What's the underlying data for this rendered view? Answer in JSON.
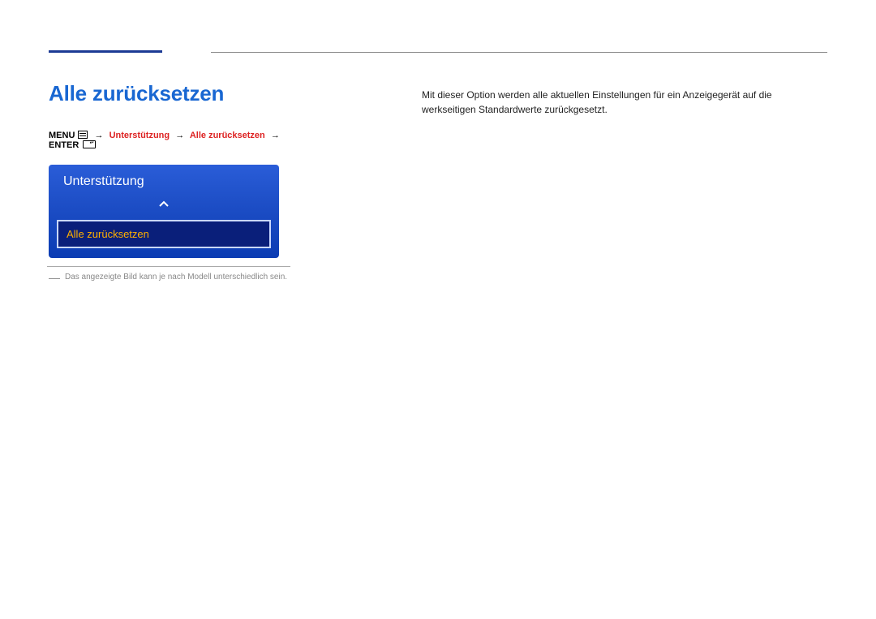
{
  "page_title": "Alle zurücksetzen",
  "breadcrumb": {
    "menu_label": "MENU",
    "unterstuetzung": "Unterstützung",
    "alle_zuruecksetzen": "Alle zurücksetzen",
    "enter_label": "ENTER"
  },
  "tv_panel": {
    "title": "Unterstützung",
    "selected_item": "Alle zurücksetzen"
  },
  "footnote": "Das angezeigte Bild kann je nach Modell unterschiedlich sein.",
  "description": "Mit dieser Option werden alle aktuellen Einstellungen für ein Anzeigegerät auf die werkseitigen Standardwerte zurückgesetzt."
}
